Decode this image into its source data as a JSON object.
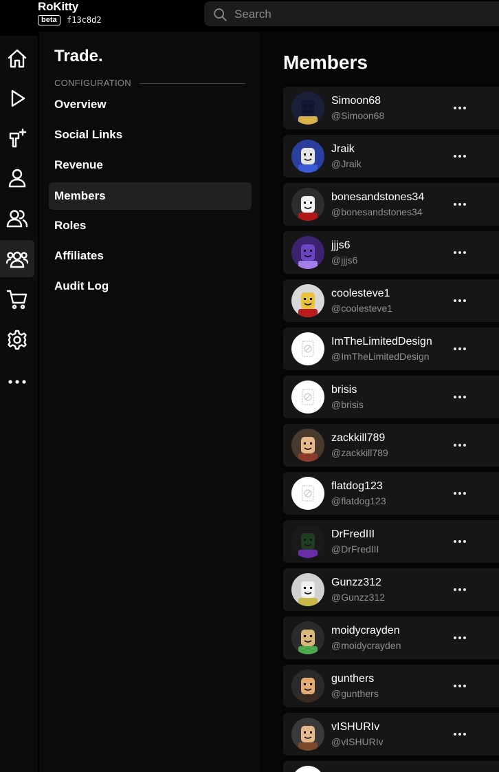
{
  "app": {
    "name": "RoKitty",
    "badge": "beta",
    "build": "f13c8d2"
  },
  "search": {
    "placeholder": "Search"
  },
  "rail": [
    "home-icon",
    "play-icon",
    "plugin-icon",
    "user-icon",
    "users-icon",
    "group-icon",
    "cart-icon",
    "gear-icon",
    "more-icon"
  ],
  "sidebar": {
    "title": "Trade.",
    "section": "CONFIGURATION",
    "items": [
      {
        "label": "Overview"
      },
      {
        "label": "Social Links"
      },
      {
        "label": "Revenue"
      },
      {
        "label": "Members"
      },
      {
        "label": "Roles"
      },
      {
        "label": "Affiliates"
      },
      {
        "label": "Audit Log"
      }
    ],
    "active": "Members"
  },
  "members": {
    "title": "Members",
    "list": [
      {
        "name": "Simoon68",
        "handle": "@Simoon68"
      },
      {
        "name": "Jraik",
        "handle": "@Jraik"
      },
      {
        "name": "bonesandstones34",
        "handle": "@bonesandstones34"
      },
      {
        "name": "jjjs6",
        "handle": "@jjjs6"
      },
      {
        "name": "coolesteve1",
        "handle": "@coolesteve1"
      },
      {
        "name": "ImTheLimitedDesign",
        "handle": "@ImTheLimitedDesign"
      },
      {
        "name": "brisis",
        "handle": "@brisis"
      },
      {
        "name": "zackkill789",
        "handle": "@zackkill789"
      },
      {
        "name": "flatdog123",
        "handle": "@flatdog123"
      },
      {
        "name": "DrFredIII",
        "handle": "@DrFredIII"
      },
      {
        "name": "Gunzz312",
        "handle": "@Gunzz312"
      },
      {
        "name": "moidycrayden",
        "handle": "@moidycrayden"
      },
      {
        "name": "gunthers",
        "handle": "@gunthers"
      },
      {
        "name": "vISHURIv",
        "handle": "@vISHURIv"
      },
      {
        "name": "",
        "handle": ""
      }
    ]
  }
}
